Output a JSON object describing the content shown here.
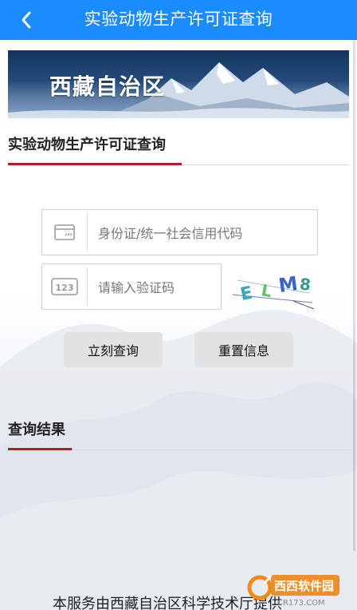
{
  "header": {
    "title": "实验动物生产许可证查询"
  },
  "banner": {
    "text": "西藏自治区"
  },
  "query_section": {
    "title": "实验动物生产许可证查询"
  },
  "form": {
    "id_placeholder": "身份证/统一社会信用代码",
    "captcha_placeholder": "请输入验证码",
    "captcha_image_text": "ELM8",
    "query_button": "立刻查询",
    "reset_button": "重置信息"
  },
  "result_section": {
    "title": "查询结果"
  },
  "footer": {
    "text": "本服务由西藏自治区科学技术厅提供"
  },
  "watermark": {
    "brand": "西西软件园",
    "domain": "CR173.COM"
  },
  "colors": {
    "topbar": "#1a8cff",
    "accent_red": "#b01e2a",
    "button_gray": "#e2e2e2"
  }
}
